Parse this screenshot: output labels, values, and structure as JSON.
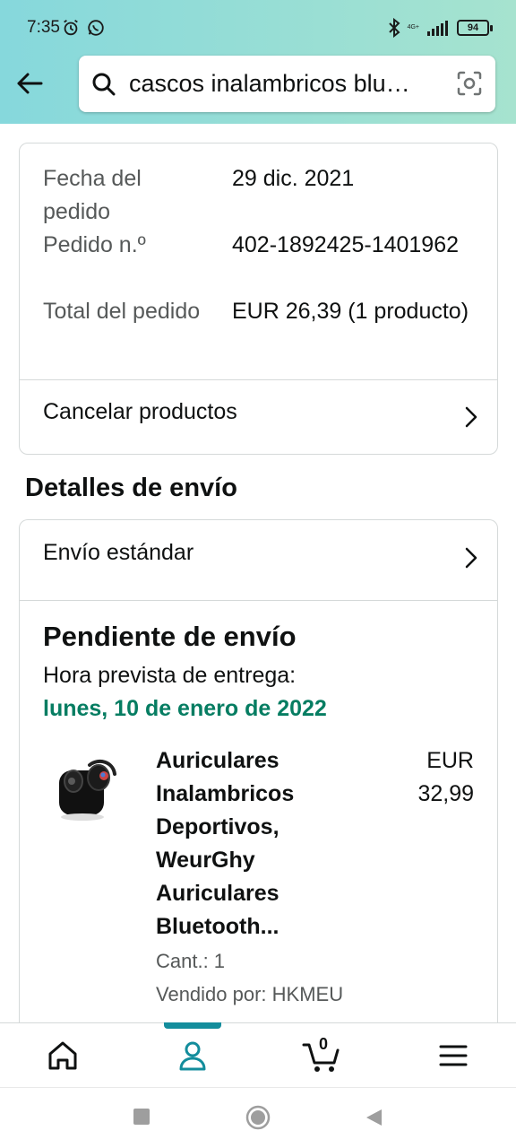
{
  "status_bar": {
    "time": "7:35",
    "battery": "94",
    "network_label": "4G+"
  },
  "search": {
    "query": "cascos inalambricos blu…"
  },
  "order_info": {
    "rows": [
      {
        "label": "Fecha del pedido",
        "value": "29 dic. 2021"
      },
      {
        "label": "Pedido n.º",
        "value": "402-1892425-1401962"
      },
      {
        "label": "Total del pedido",
        "value": "EUR 26,39 (1 producto)"
      }
    ],
    "cancel_label": "Cancelar productos"
  },
  "shipping": {
    "section_title": "Detalles de envío",
    "method_label": "Envío estándar",
    "status_title": "Pendiente de envío",
    "eta_label": "Hora prevista de entrega:",
    "eta_date": "lunes, 10 de enero de 2022"
  },
  "product": {
    "title": "Auriculares Inalambricos Deportivos, WeurGhy Auriculares Bluetooth...",
    "price": "EUR 32,99",
    "quantity": "Cant.: 1",
    "seller": "Vendido por: HKMEU"
  },
  "bottom_nav": {
    "cart_count": "0",
    "active": "profile",
    "accent_color": "#138d9c"
  },
  "colors": {
    "header_gradient_start": "#86d8dc",
    "header_gradient_end": "#a6e3cf",
    "eta_green": "#067d62"
  }
}
